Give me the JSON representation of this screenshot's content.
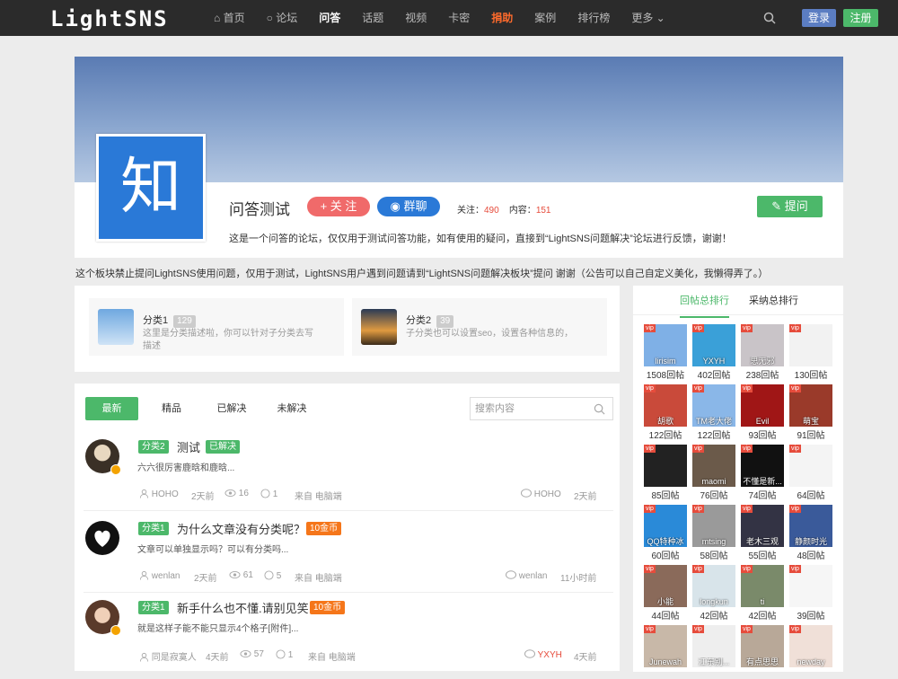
{
  "header": {
    "logo": "LightSNS",
    "nav": [
      {
        "label": "首页",
        "icon": "home-icon"
      },
      {
        "label": "论坛",
        "icon": "comments-icon"
      },
      {
        "label": "问答",
        "active": true
      },
      {
        "label": "话题"
      },
      {
        "label": "视频"
      },
      {
        "label": "卡密"
      },
      {
        "label": "捐助",
        "hot": true
      },
      {
        "label": "案例"
      },
      {
        "label": "排行榜"
      },
      {
        "label": "更多",
        "icon": "chevron-down-icon"
      }
    ],
    "login_label": "登录",
    "register_label": "注册"
  },
  "forum": {
    "icon_glyph": "知",
    "title": "问答测试",
    "follow_label": "+ 关 注",
    "group_chat_label": "群聊",
    "follow_count_label": "关注：",
    "follow_count": "490",
    "content_count_label": "内容：",
    "content_count": "151",
    "ask_label": "提问",
    "description": "这是一个问答的论坛，仅仅用于测试问答功能，如有使用的疑问，直接到“LightSNS问题解决”论坛进行反馈，谢谢！"
  },
  "notice": "这个板块禁止提问LightSNS使用问题，仅用于测试，LightSNS用户遇到问题请到“LightSNS问题解决板块”提问 谢谢（公告可以自己自定义美化，我懒得弄了。）",
  "categories": [
    {
      "name": "分类1",
      "count": "129",
      "desc": "这里是分类描述啦，你可以针对子分类去写描述"
    },
    {
      "name": "分类2",
      "count": "39",
      "desc": "子分类也可以设置seo，设置各种信息的，"
    }
  ],
  "tabs": [
    "最新",
    "精品",
    "已解决",
    "未解决"
  ],
  "search": {
    "placeholder": "搜索内容"
  },
  "posts": [
    {
      "category": "分类2",
      "title": "测试",
      "tag": "已解决",
      "excerpt": "六六很厉害鹿晗和鹿晗...",
      "author": "HOHO",
      "time": "2天前",
      "views": "16",
      "comments": "1",
      "source": "来自 电脑端",
      "last_reply_user": "HOHO",
      "last_reply_time": "2天前"
    },
    {
      "category": "分类1",
      "title": "为什么文章没有分类呢？",
      "tag": "10金币",
      "excerpt": "文章可以单独显示吗？可以有分类吗...",
      "author": "wenlan",
      "time": "2天前",
      "views": "61",
      "comments": "5",
      "source": "来自 电脑端",
      "last_reply_user": "wenlan",
      "last_reply_time": "11小时前"
    },
    {
      "category": "分类1",
      "title": "新手什么也不懂.请别见笑",
      "tag": "10金币",
      "excerpt": "就是这样子能不能只显示4个格子[附件]...",
      "author": "同是寂寞人",
      "time": "4天前",
      "views": "57",
      "comments": "1",
      "source": "来自 电脑端",
      "last_reply_user": "YXYH",
      "last_reply_time": "4天前"
    }
  ],
  "sidebar": {
    "tabs": [
      "回帖总排行",
      "采纳总排行"
    ],
    "vip_label": "vip",
    "ranks": [
      {
        "name": "lirisim",
        "count": "1508回帖",
        "color": "#7fb0e6"
      },
      {
        "name": "YXYH",
        "count": "402回帖",
        "color": "#3aa0d8"
      },
      {
        "name": "思无邪",
        "count": "238回帖",
        "color": "#c9c4c8"
      },
      {
        "name": "",
        "count": "130回帖",
        "color": "#f2f2f2"
      },
      {
        "name": "胡歌",
        "count": "122回帖",
        "color": "#c94a3a"
      },
      {
        "name": "TM老大佬",
        "count": "122回帖",
        "color": "#8ab7e8"
      },
      {
        "name": "Evil",
        "count": "93回帖",
        "color": "#a01616"
      },
      {
        "name": "萌宝",
        "count": "91回帖",
        "color": "#9a3a2a"
      },
      {
        "name": "",
        "count": "85回帖",
        "color": "#222222"
      },
      {
        "name": "maomi",
        "count": "76回帖",
        "color": "#6b5a4a"
      },
      {
        "name": "不懂是新...",
        "count": "74回帖",
        "color": "#111111"
      },
      {
        "name": "",
        "count": "64回帖",
        "color": "#f4f4f4"
      },
      {
        "name": "QQ特种冰",
        "count": "60回帖",
        "color": "#2a8ad8"
      },
      {
        "name": "mtsing",
        "count": "58回帖",
        "color": "#9a9a9a"
      },
      {
        "name": "老木三观",
        "count": "55回帖",
        "color": "#333344"
      },
      {
        "name": "静颜时光",
        "count": "48回帖",
        "color": "#3a5a9a"
      },
      {
        "name": "小能",
        "count": "44回帖",
        "color": "#8a6a5a"
      },
      {
        "name": "longkun",
        "count": "42回帖",
        "color": "#d8e4ea"
      },
      {
        "name": "ti",
        "count": "42回帖",
        "color": "#7a8a6a"
      },
      {
        "name": "",
        "count": "39回帖",
        "color": "#f6f6f6"
      },
      {
        "name": "Junewah",
        "count": "",
        "color": "#c8b8a8"
      },
      {
        "name": "江东别...",
        "count": "",
        "color": "#eeeeee"
      },
      {
        "name": "有点思思",
        "count": "",
        "color": "#b8a898"
      },
      {
        "name": "newday",
        "count": "",
        "color": "#f0e0d8"
      }
    ]
  }
}
